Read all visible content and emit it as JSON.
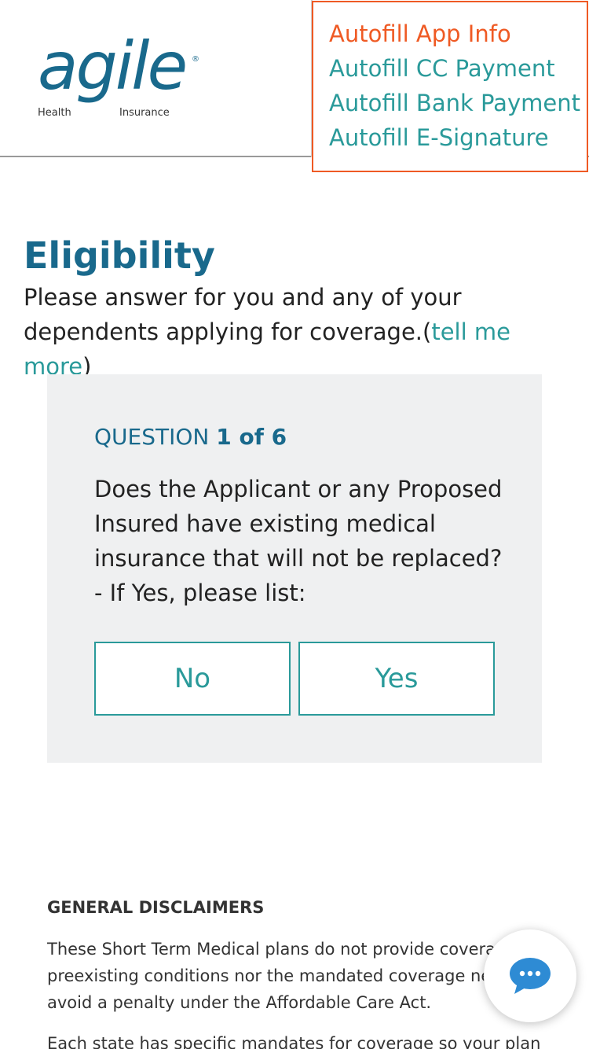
{
  "logo": {
    "word": "agile",
    "registered": "®",
    "sub_left": "Health",
    "sub_right": "Insurance"
  },
  "autofill": {
    "items": [
      {
        "label": "Autofill App Info"
      },
      {
        "label": "Autofill CC Payment"
      },
      {
        "label": "Autofill Bank Payment"
      },
      {
        "label": "Autofill E-Signature"
      }
    ]
  },
  "page": {
    "title": "Eligibility",
    "intro_text": "Please answer for you and any of your dependents applying for coverage.(",
    "intro_link": "tell me more",
    "intro_close": ")"
  },
  "question": {
    "label": "QUESTION ",
    "counter": "1 of 6",
    "text": "Does the Applicant or any Proposed Insured have existing medical insurance that will not be replaced?",
    "subtext": "- If Yes, please list:",
    "no_label": "No",
    "yes_label": "Yes"
  },
  "disclaimers": {
    "title": "GENERAL DISCLAIMERS",
    "p1": "These Short Term Medical plans do not provide coverage for preexisting conditions nor the mandated coverage needed to avoid a penalty under the Affordable Care Act.",
    "p2": "Each state has specific mandates for coverage so your plan"
  },
  "colors": {
    "brand": "#19698c",
    "accent": "#2a9a9a",
    "autofill_active": "#ef5a24",
    "card_bg": "#eff0f1",
    "chat_icon": "#2e8bd4"
  },
  "icons": {
    "chat": "chat-bubble-icon"
  }
}
